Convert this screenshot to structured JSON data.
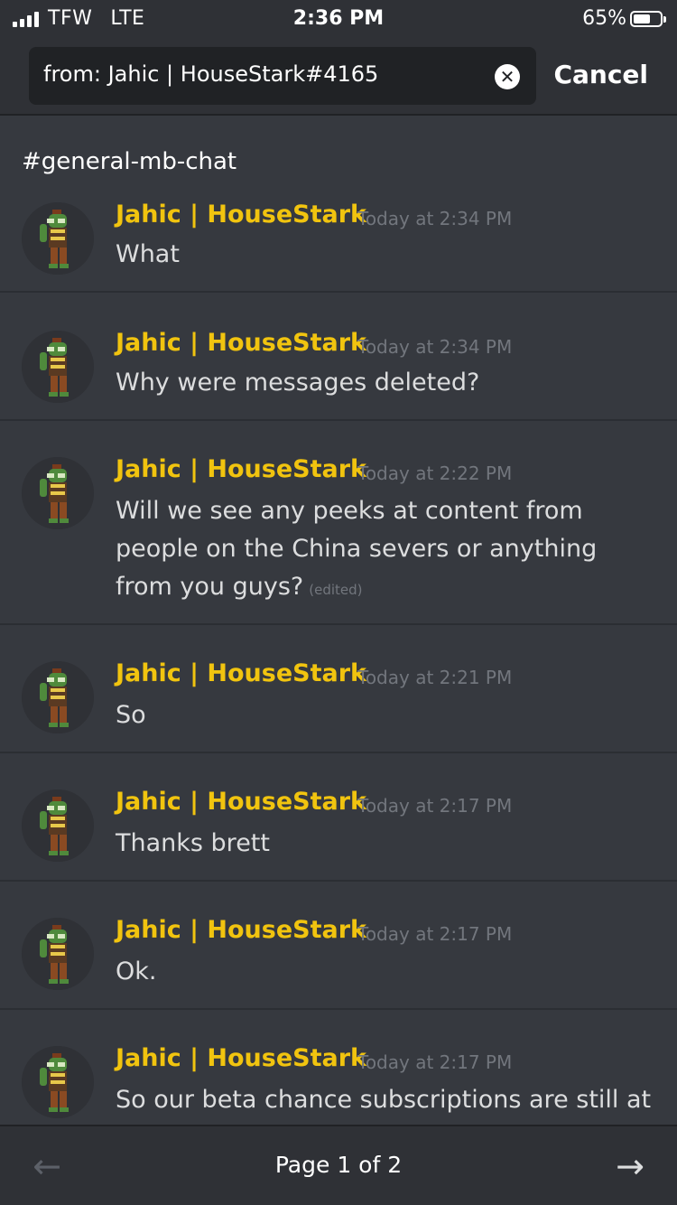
{
  "status_bar": {
    "carrier": "TFW",
    "network": "LTE",
    "time": "2:36 PM",
    "battery": "65%",
    "battery_level": 0.65
  },
  "search": {
    "query": "from: Jahic | HouseStark#4165",
    "cancel_label": "Cancel",
    "clear_icon": "close-circle-icon"
  },
  "channel": {
    "name": "#general-mb-chat"
  },
  "messages": [
    {
      "author": "Jahic | HouseStark",
      "timestamp": "Today at 2:34 PM",
      "text": "What",
      "edited": ""
    },
    {
      "author": "Jahic | HouseStark",
      "timestamp": "Today at 2:34 PM",
      "text": "Why were messages deleted?",
      "edited": ""
    },
    {
      "author": "Jahic | HouseStark",
      "timestamp": "Today at 2:22 PM",
      "text": "Will we see any peeks at content from people on the China severs or anything from you guys?",
      "edited": "(edited)"
    },
    {
      "author": "Jahic | HouseStark",
      "timestamp": "Today at 2:21 PM",
      "text": "So",
      "edited": ""
    },
    {
      "author": "Jahic | HouseStark",
      "timestamp": "Today at 2:17 PM",
      "text": "Thanks brett",
      "edited": ""
    },
    {
      "author": "Jahic | HouseStark",
      "timestamp": "Today at 2:17 PM",
      "text": "Ok.",
      "edited": ""
    },
    {
      "author": "Jahic | HouseStark",
      "timestamp": "Today at 2:17 PM",
      "text": "So our beta chance subscriptions are still at",
      "edited": ""
    }
  ],
  "footer": {
    "page_label": "Page 1 of 2",
    "prev_icon": "arrow-left-icon",
    "next_icon": "arrow-right-icon"
  },
  "colors": {
    "background": "#36393f",
    "header": "#2f3136",
    "author": "#f1c40f",
    "timestamp": "#72767d"
  }
}
